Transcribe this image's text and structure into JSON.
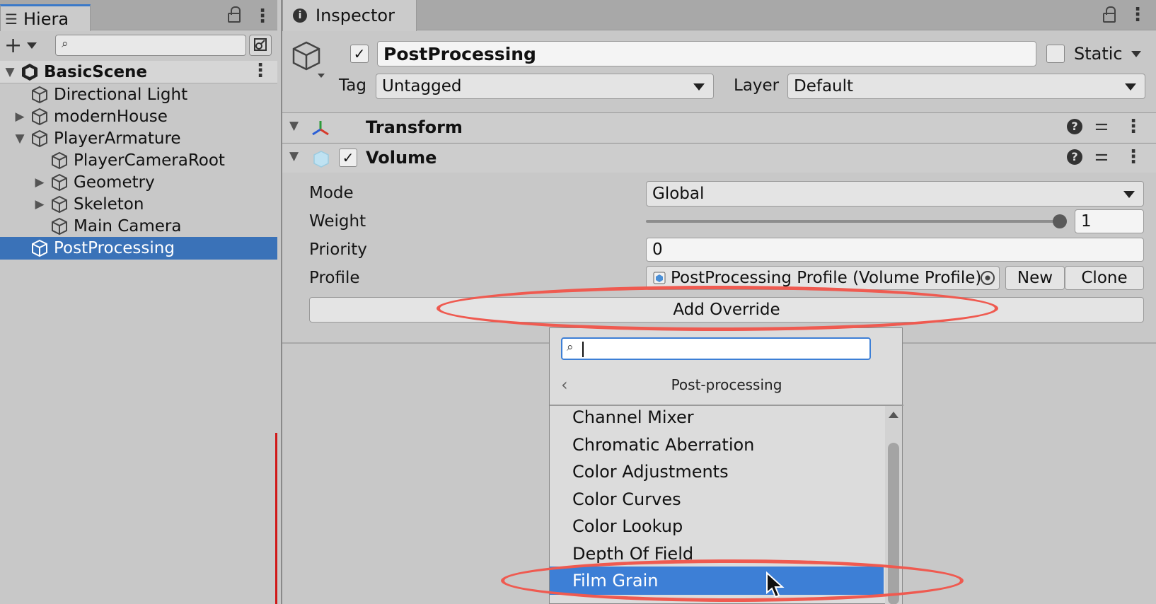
{
  "hierarchy": {
    "tab_label": "Hiera",
    "search_placeholder": "",
    "scene": "BasicScene",
    "items": [
      {
        "label": "Directional Light",
        "depth": 1,
        "expander": ""
      },
      {
        "label": "modernHouse",
        "depth": 1,
        "expander": "▶"
      },
      {
        "label": "PlayerArmature",
        "depth": 1,
        "expander": "▼"
      },
      {
        "label": "PlayerCameraRoot",
        "depth": 2,
        "expander": ""
      },
      {
        "label": "Geometry",
        "depth": 2,
        "expander": "▶"
      },
      {
        "label": "Skeleton",
        "depth": 2,
        "expander": "▶"
      },
      {
        "label": "Main Camera",
        "depth": 2,
        "expander": ""
      },
      {
        "label": "PostProcessing",
        "depth": 1,
        "expander": "",
        "selected": true
      }
    ]
  },
  "inspector": {
    "tab_label": "Inspector",
    "object_name": "PostProcessing",
    "active_checked": true,
    "static_label": "Static",
    "tag_label": "Tag",
    "tag_value": "Untagged",
    "layer_label": "Layer",
    "layer_value": "Default",
    "components": {
      "transform": {
        "title": "Transform"
      },
      "volume": {
        "title": "Volume",
        "enabled": true
      }
    },
    "volume_fields": {
      "mode_label": "Mode",
      "mode_value": "Global",
      "weight_label": "Weight",
      "weight_value": "1",
      "priority_label": "Priority",
      "priority_value": "0",
      "profile_label": "Profile",
      "profile_value": "PostProcessing Profile (Volume Profile)",
      "new_button": "New",
      "clone_button": "Clone",
      "add_override_button": "Add Override"
    }
  },
  "dropdown": {
    "search_value": "",
    "breadcrumb": "Post-processing",
    "back_glyph": "‹",
    "items": [
      "Channel Mixer",
      "Chromatic Aberration",
      "Color Adjustments",
      "Color Curves",
      "Color Lookup",
      "Depth Of Field",
      "Film Grain"
    ],
    "highlighted_item": "Film Grain"
  },
  "colors": {
    "selection_blue": "#3a72b8",
    "highlight_blue": "#3d7fd6",
    "annotation_red": "#ef5a50",
    "panel_gray": "#c8c8c8"
  }
}
